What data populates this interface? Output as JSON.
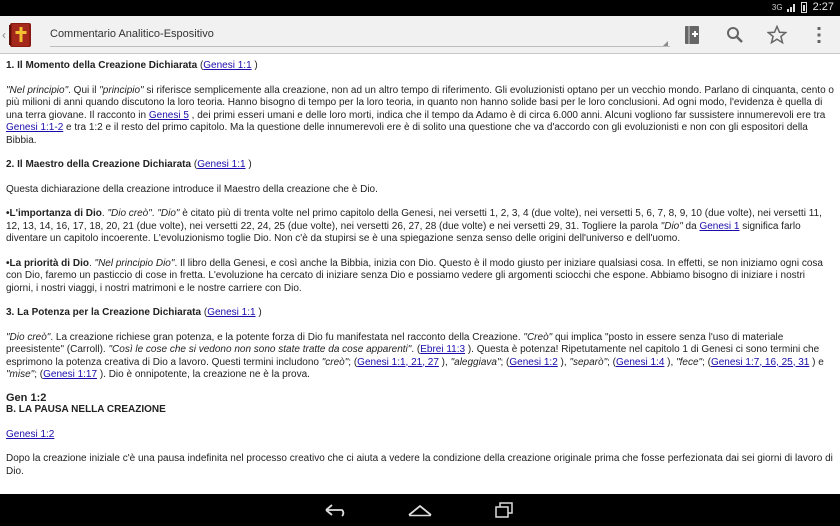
{
  "status": {
    "network": "3G",
    "time": "2:27"
  },
  "header": {
    "title": "Commentario Analitico-Espositivo"
  },
  "icons": {
    "app": "bible-book-icon",
    "add_bookmark": "bookmark-add-icon",
    "search": "search-icon",
    "favorite": "star-icon",
    "overflow": "overflow-menu-icon",
    "back": "back-icon",
    "home": "home-icon",
    "recents": "recent-apps-icon"
  },
  "content": {
    "s1": {
      "heading": "1. Il Momento della Creazione Dichiarata",
      "ref": "Genesi 1:1"
    },
    "p1": {
      "t1": "\"Nel principio\"",
      "t2": ". Qui il ",
      "t3": "\"principio\"",
      "t4": " si riferisce semplicemente alla creazione, non ad un altro tempo di riferimento. Gli evoluzionisti optano per un vecchio mondo. Parlano di cinquanta, cento o più milioni di anni quando discutono la loro teoria. Hanno bisogno di tempo per la loro teoria, in quanto non hanno solide basi per le loro conclusioni. Ad ogni modo, l'evidenza è quella di una terra giovane. Il racconto in ",
      "l1": "Genesi 5",
      "t5": " , dei primi esseri umani e delle loro morti, indica che il tempo da Adamo è di circa 6.000 anni. Alcuni vogliono far sussistere innumerevoli ere tra ",
      "l2": "Genesi 1:1-2",
      "t6": " e tra 1:2 e il resto del primo capitolo. Ma la questione delle innumerevoli ere è di solito una questione che va d'accordo con gli evoluzionisti e non con gli espositori della Bibbia."
    },
    "s2": {
      "heading": "2. Il Maestro della Creazione Dichiarata",
      "ref": "Genesi 1:1"
    },
    "p2": "Questa dichiarazione della creazione introduce il Maestro della creazione che è Dio.",
    "p3": {
      "b": "•L'importanza di Dio",
      "t1": ". ",
      "i1": "\"Dio creò\"",
      "t2": ". ",
      "i2": "\"Dio\"",
      "t3": " è citato più di trenta volte nel primo capitolo della Genesi, nei versetti 1, 2, 3, 4 (due volte), nei versetti 5, 6, 7, 8, 9, 10 (due volte), nei versetti 11, 12, 13, 14, 16, 17, 18, 20, 21 (due volte), nei versetti 22, 24, 25 (due volte), nei versetti 26, 27, 28 (due volte) e nei versetti 29, 31. Togliere la parola ",
      "i3": "\"Dio\"",
      "t4": " da ",
      "l1": "Genesi 1",
      "t5": " significa farlo diventare un capitolo incoerente. L'evoluzionismo toglie Dio. Non c'è da stupirsi se è una spiegazione senza senso delle origini dell'universo e dell'uomo."
    },
    "p4": {
      "b": "•La priorità di Dio",
      "t1": ". ",
      "i1": "\"Nel principio Dio\"",
      "t2": ". Il libro della Genesi, e così anche la Bibbia, inizia con Dio. Questo è il modo giusto per iniziare qualsiasi cosa. In effetti, se non iniziamo ogni cosa con Dio, faremo un pasticcio di cose in fretta. L'evoluzione ha cercato di iniziare senza Dio e possiamo vedere gli argomenti sciocchi che espone. Abbiamo bisogno di iniziare i nostri giorni, i nostri viaggi, i nostri matrimoni e le nostre carriere con Dio."
    },
    "s3": {
      "heading": "3. La Potenza per la Creazione Dichiarata",
      "ref": "Genesi 1:1"
    },
    "p5": {
      "i1": "\"Dio creò\"",
      "t1": ". La creazione richiese gran potenza, e la potente forza di Dio fu manifestata nel racconto della Creazione. ",
      "i2": "\"Creò\"",
      "t2": " qui implica \"posto in essere senza l'uso di materiale preesistente\" (Carroll). ",
      "i3": "\"Così le cose che si vedono non sono state tratte da cose apparenti\"",
      "t3": ". (",
      "l1": "Ebrei 11:3",
      "t4": " ). Questa è potenza! Ripetutamente nel capitolo 1 di Genesi ci sono termini che esprimono la potenza creativa di Dio a lavoro. Questi termini includono ",
      "i4": "\"creò\"",
      "t5": "; (",
      "l2": "Genesi 1:1, 21, 27",
      "t6": " ), ",
      "i5": "\"aleggiava\"",
      "t7": "; (",
      "l3": "Genesi 1:2",
      "t8": " ), ",
      "i6": "\"separò\"",
      "t9": "; (",
      "l4": "Genesi 1:4",
      "t10": " ), ",
      "i7": "\"fece\"",
      "t11": "; (",
      "l5": "Genesi 1:7, 16, 25, 31",
      "t12": " ) e ",
      "i8": "\"mise\"",
      "t13": "; (",
      "l6": "Genesi 1:17",
      "t14": " ). Dio è onnipotente, la creazione ne è la prova."
    },
    "gen": "Gen 1:2",
    "sectionB": "B. LA PAUSA NELLA CREAZIONE",
    "refB": "Genesi 1:2",
    "p6": "Dopo la creazione iniziale c'è una pausa indefinita nel processo creativo che ci aiuta a vedere la condizione della creazione originale prima che fosse perfezionata dai sei giorni di lavoro di Dio."
  }
}
